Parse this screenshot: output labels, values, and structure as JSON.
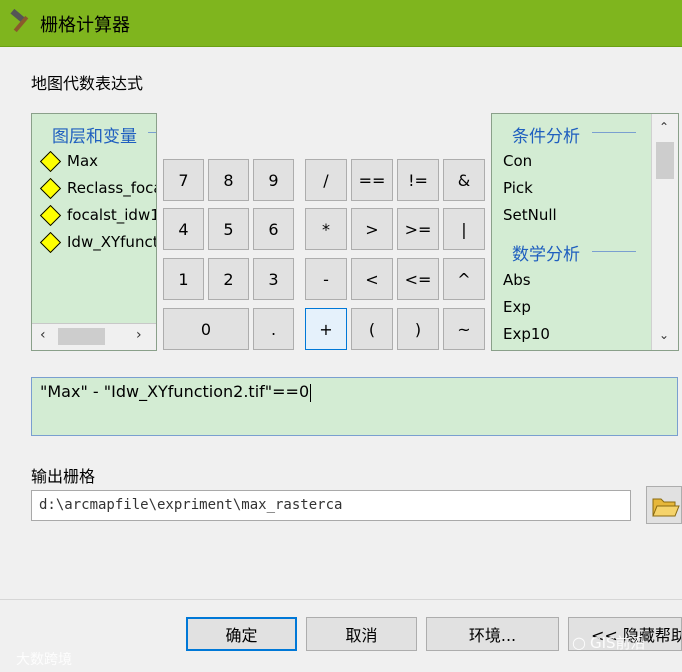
{
  "window": {
    "title": "栅格计算器"
  },
  "map_algebra_label": "地图代数表达式",
  "layers_panel": {
    "header": "图层和变量",
    "items": [
      "Max",
      "Reclass_foca",
      "focalst_idw1",
      "Idw_XYfunct"
    ]
  },
  "functions_panel": {
    "sections": [
      {
        "header": "条件分析",
        "items": [
          "Con",
          "Pick",
          "SetNull"
        ]
      },
      {
        "header": "数学分析",
        "items": [
          "Abs",
          "Exp",
          "Exp10"
        ]
      }
    ]
  },
  "keypad": {
    "numbers": [
      "7",
      "8",
      "9",
      "4",
      "5",
      "6",
      "1",
      "2",
      "3",
      "0",
      "."
    ],
    "operators": [
      "/",
      "==",
      "!=",
      "&",
      "*",
      ">",
      ">=",
      "|",
      "-",
      "<",
      "<=",
      "^",
      "+",
      "(",
      ")",
      "~"
    ]
  },
  "expression": "\"Max\" - \"Idw_XYfunction2.tif\"==0",
  "output": {
    "label": "输出栅格",
    "value": "d:\\arcmapfile\\expriment\\max_rasterca"
  },
  "buttons": {
    "ok": "确定",
    "cancel": "取消",
    "environments": "环境...",
    "hide_help": "<< 隐藏帮助"
  },
  "watermarks": {
    "left": "大数跨境",
    "right": "GIS前沿"
  },
  "colors": {
    "titlebar": "#7fb51e",
    "panel_bg": "#d3ecd3",
    "header_text": "#1f5fbf",
    "layer_symbol": "#ffff00"
  }
}
